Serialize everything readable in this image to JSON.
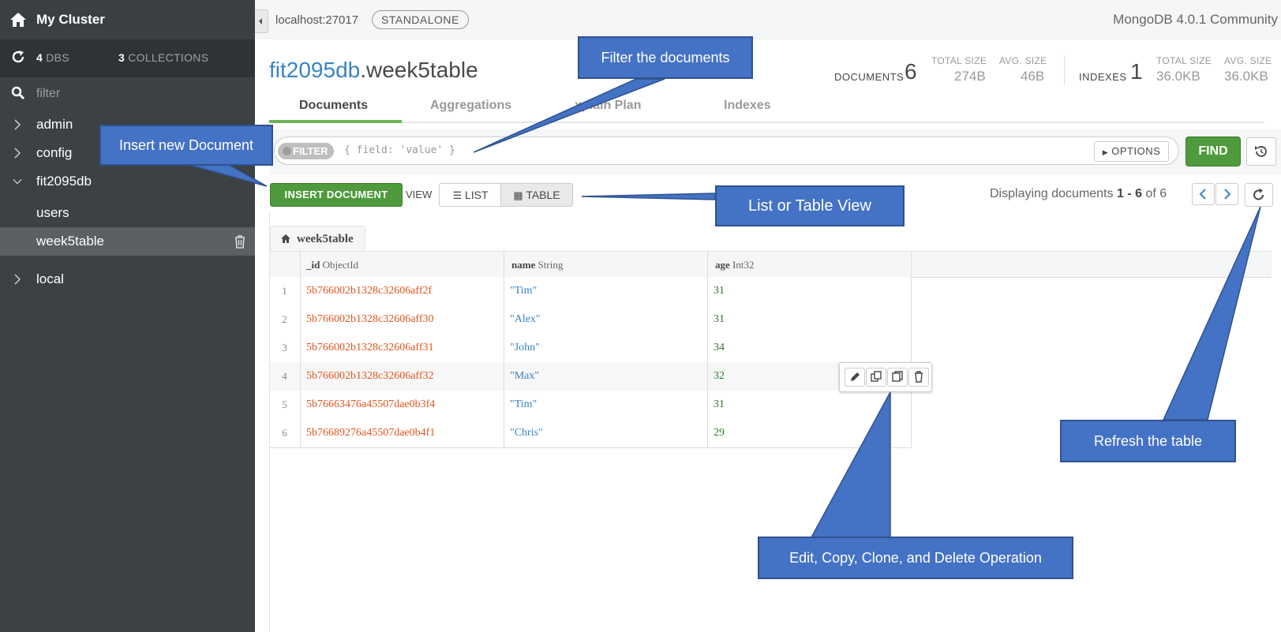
{
  "sidebar": {
    "cluster_name": "My Cluster",
    "dbs_count": "4",
    "dbs_label": "DBS",
    "collections_count": "3",
    "collections_label": "COLLECTIONS",
    "filter_placeholder": "filter",
    "databases": [
      {
        "name": "admin",
        "expanded": false
      },
      {
        "name": "config",
        "expanded": false
      },
      {
        "name": "fit2095db",
        "expanded": true,
        "collections": [
          "users",
          "week5table"
        ]
      },
      {
        "name": "local",
        "expanded": false
      }
    ],
    "active_collection": "week5table"
  },
  "topbar": {
    "host": "localhost:27017",
    "topology": "STANDALONE",
    "version": "MongoDB 4.0.1 Community"
  },
  "collection": {
    "db": "fit2095db",
    "name": ".week5table",
    "documents_label": "DOCUMENTS",
    "documents_count": "6",
    "doc_total_size_label": "TOTAL SIZE",
    "doc_total_size": "274B",
    "doc_avg_size_label": "AVG. SIZE",
    "doc_avg_size": "46B",
    "indexes_label": "INDEXES",
    "indexes_count": "1",
    "idx_total_size_label": "TOTAL SIZE",
    "idx_total_size": "36.0KB",
    "idx_avg_size_label": "AVG. SIZE",
    "idx_avg_size": "36.0KB"
  },
  "tabs": [
    {
      "label": "Documents",
      "active": true
    },
    {
      "label": "Aggregations",
      "active": false
    },
    {
      "label": "xplain Plan",
      "active": false
    },
    {
      "label": "Indexes",
      "active": false
    }
  ],
  "query": {
    "filter_badge": "FILTER",
    "filter_placeholder": "{ field: 'value' }",
    "options_label": "OPTIONS",
    "find_label": "FIND"
  },
  "toolbar": {
    "insert_label": "INSERT DOCUMENT",
    "view_label": "VIEW",
    "list_label": "LIST",
    "table_label": "TABLE",
    "display_prefix": "Displaying documents ",
    "display_range": "1 - 6",
    "display_of": " of 6"
  },
  "table": {
    "breadcrumb": "week5table",
    "columns": [
      {
        "field": "_id",
        "type": "ObjectId"
      },
      {
        "field": "name",
        "type": "String"
      },
      {
        "field": "age",
        "type": "Int32"
      }
    ],
    "rows": [
      {
        "index": "1",
        "id": "5b766002b1328c32606aff2f",
        "name": "\"Tim\"",
        "age": "31"
      },
      {
        "index": "2",
        "id": "5b766002b1328c32606aff30",
        "name": "\"Alex\"",
        "age": "31"
      },
      {
        "index": "3",
        "id": "5b766002b1328c32606aff31",
        "name": "\"John\"",
        "age": "34"
      },
      {
        "index": "4",
        "id": "5b766002b1328c32606aff32",
        "name": "\"Max\"",
        "age": "32"
      },
      {
        "index": "5",
        "id": "5b76663476a45507dae0b3f4",
        "name": "\"Tim\"",
        "age": "31"
      },
      {
        "index": "6",
        "id": "5b76689276a45507dae0b4f1",
        "name": "\"Chris\"",
        "age": "29"
      }
    ]
  },
  "callouts": {
    "filter": "Filter the documents",
    "insert": "Insert new Document",
    "view": "List or Table View",
    "refresh": "Refresh the table",
    "actions": "Edit, Copy, Clone, and Delete Operation"
  },
  "colors": {
    "sidebar_bg": "#3c4144",
    "accent_green": "#4f9a3c",
    "db_blue": "#3a84c1",
    "objectid_orange": "#e0561e",
    "callout_blue": "#4472c4"
  }
}
